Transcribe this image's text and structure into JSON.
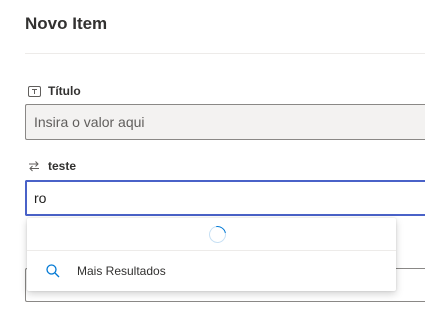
{
  "page": {
    "title": "Novo Item"
  },
  "fields": [
    {
      "label": "Título",
      "icon": "text-field-icon",
      "placeholder": "Insira o valor aqui",
      "value": ""
    },
    {
      "label": "teste",
      "icon": "lookup-arrows-icon",
      "value": "ro"
    }
  ],
  "dropdown": {
    "loading": true,
    "more_results_label": "Mais Resultados",
    "more_results_icon": "search-icon"
  },
  "colors": {
    "focus_border": "#4a62c8",
    "spinner": "#0078d4",
    "search_icon": "#0078d4"
  }
}
